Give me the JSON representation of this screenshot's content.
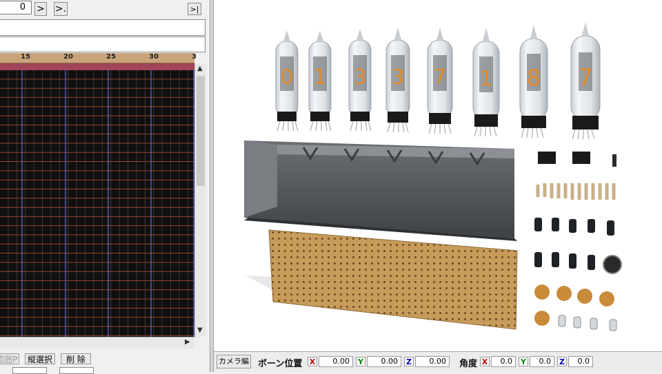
{
  "timeline": {
    "frame_value": "0",
    "next_button": ">",
    "next_key_button": ">.",
    "last_button": ">|",
    "ruler_ticks": [
      "15",
      "20",
      "25",
      "30",
      "3"
    ],
    "buttons": {
      "partial_left": "範囲P",
      "vertical_select": "縦選択",
      "delete": "削 除"
    }
  },
  "bottom_bar": {
    "camera_edit": "カメラ編",
    "bone_position_label": "ボーン位置",
    "angle_label": "角度",
    "axis_x": "X",
    "axis_y": "Y",
    "axis_z": "Z",
    "position": {
      "x": "0.00",
      "y": "0.00",
      "z": "0.00"
    },
    "angle": {
      "x": "0.0",
      "y": "0.0",
      "z": "0.0"
    },
    "colors": {
      "x": "#c00000",
      "y": "#008000",
      "z": "#0000c0"
    }
  },
  "scene": {
    "tube_digits": [
      "0",
      "1",
      "3",
      "3",
      "7",
      "1",
      "8",
      "7"
    ],
    "colors": {
      "digit_glow": "#e08a2a",
      "enclosure": "#505458",
      "perfboard": "#c9a060",
      "capacitor_ceramic": "#c98a3a",
      "capacitor_electrolytic": "#1e2226"
    }
  }
}
